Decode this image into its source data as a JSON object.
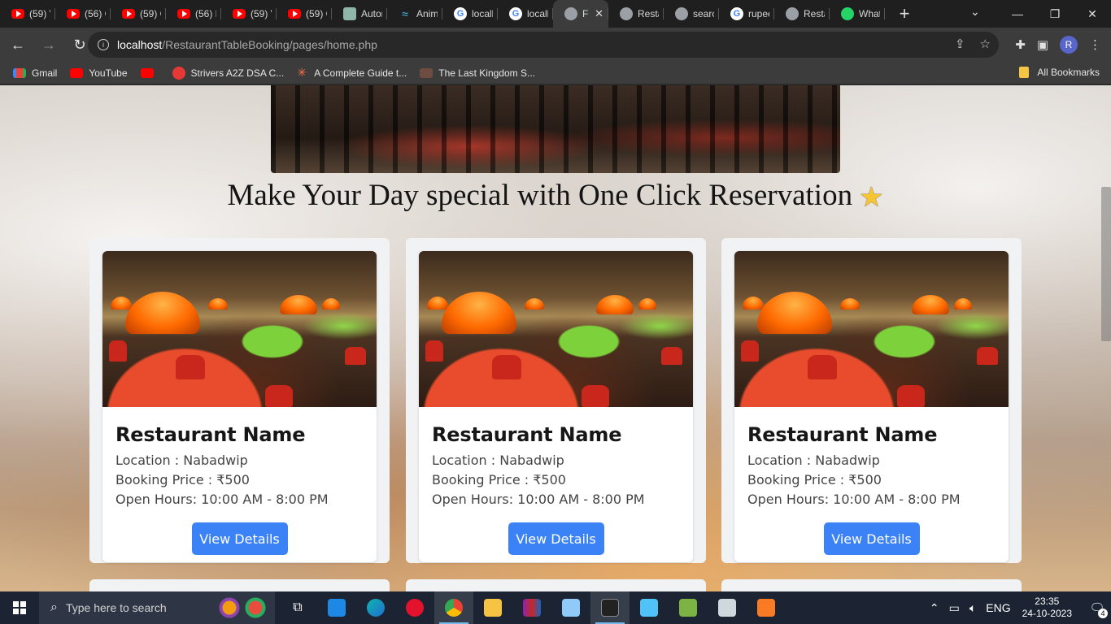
{
  "browser": {
    "tabs": [
      {
        "label": "(59) V",
        "icon": "youtube-icon"
      },
      {
        "label": "(56) C",
        "icon": "youtube-icon"
      },
      {
        "label": "(59) C",
        "icon": "youtube-icon"
      },
      {
        "label": "(56) F",
        "icon": "youtube-icon"
      },
      {
        "label": "(59) V",
        "icon": "youtube-icon"
      },
      {
        "label": "(59) C",
        "icon": "youtube-icon"
      },
      {
        "label": "Autor",
        "icon": "chatgpt-icon"
      },
      {
        "label": "Anim",
        "icon": "animation-icon"
      },
      {
        "label": "locall",
        "icon": "google-icon"
      },
      {
        "label": "locall",
        "icon": "google-icon"
      },
      {
        "label": "F",
        "icon": "globe-icon",
        "active": true
      },
      {
        "label": "Resta",
        "icon": "globe-icon"
      },
      {
        "label": "searc",
        "icon": "globe-icon"
      },
      {
        "label": "rupee",
        "icon": "google-icon"
      },
      {
        "label": "Resta",
        "icon": "globe-icon"
      },
      {
        "label": "What",
        "icon": "whatsapp-icon"
      }
    ],
    "url_host": "localhost",
    "url_path": "/RestaurantTableBooking/pages/home.php",
    "profile_initial": "R",
    "bookmarks": [
      {
        "label": "Gmail",
        "icon": "gmail-icon"
      },
      {
        "label": "YouTube",
        "icon": "youtube-icon"
      },
      {
        "label": "",
        "icon": "youtube-icon"
      },
      {
        "label": "Strivers A2Z DSA C...",
        "icon": "tuf-icon"
      },
      {
        "label": "A Complete Guide t...",
        "icon": "asterisk-icon"
      },
      {
        "label": "The Last Kingdom S...",
        "icon": "film-icon"
      }
    ],
    "all_bookmarks": "All Bookmarks"
  },
  "page": {
    "headline": "Make Your Day special with One Click Reservation",
    "headline_icon": "star-icon",
    "cards": [
      {
        "name": "Restaurant Name",
        "location": "Location : Nabadwip",
        "price": "Booking Price : ₹500",
        "hours": "Open Hours: 10:00 AM - 8:00 PM",
        "button": "View Details"
      },
      {
        "name": "Restaurant Name",
        "location": "Location : Nabadwip",
        "price": "Booking Price : ₹500",
        "hours": "Open Hours: 10:00 AM - 8:00 PM",
        "button": "View Details"
      },
      {
        "name": "Restaurant Name",
        "location": "Location : Nabadwip",
        "price": "Booking Price : ₹500",
        "hours": "Open Hours: 10:00 AM - 8:00 PM",
        "button": "View Details"
      }
    ]
  },
  "taskbar": {
    "search_placeholder": "Type here to search",
    "language": "ENG",
    "time": "23:35",
    "date": "24-10-2023",
    "notification_count": "4"
  },
  "colors": {
    "accent_button": "#3b82f6",
    "taskbar": "#1c2433",
    "browser_frame": "#3c3c3c"
  }
}
